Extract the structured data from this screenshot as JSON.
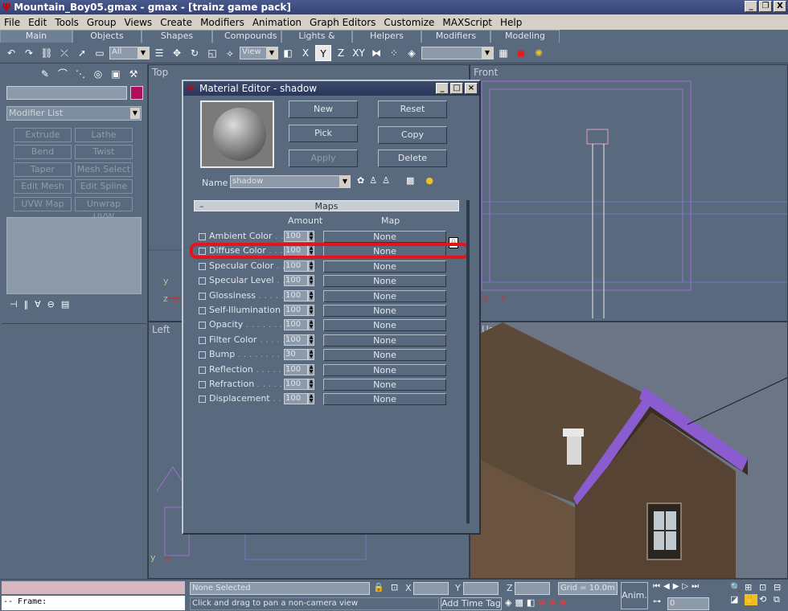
{
  "window": {
    "title": "Mountain_Boy05.gmax - gmax - [trainz game pack]",
    "controls": [
      "_",
      "❐",
      "X"
    ]
  },
  "menu": [
    "File",
    "Edit",
    "Tools",
    "Group",
    "Views",
    "Create",
    "Modifiers",
    "Animation",
    "Graph Editors",
    "Customize",
    "MAXScript",
    "Help"
  ],
  "toolbar_tabs": [
    "Main Toolbar",
    "Objects",
    "Shapes",
    "Compounds",
    "Lights & Cameras",
    "Helpers",
    "Modifiers",
    "Modeling"
  ],
  "toolbar": {
    "selection_filter": "All",
    "ref_coord": "View",
    "active_tool": "Y",
    "axis_labels": [
      "X",
      "Y",
      "Z",
      "XY"
    ]
  },
  "left_panel": {
    "modifier_list": "Modifier List",
    "modifier_buttons": [
      "Extrude",
      "Lathe",
      "Bend",
      "Twist",
      "Taper",
      "Mesh Select",
      "Edit Mesh",
      "Edit Spline",
      "UVW Map",
      "Unwrap UVW"
    ],
    "accent_color": "#b0105a"
  },
  "viewports": {
    "top": "Top",
    "front": "Front",
    "left": "Left",
    "user": "User"
  },
  "material_editor": {
    "title": "Material Editor - shadow",
    "buttons": {
      "new": "New",
      "reset": "Reset",
      "pick": "Pick",
      "copy": "Copy",
      "apply": "Apply",
      "delete": "Delete"
    },
    "name_label": "Name",
    "name_value": "shadow",
    "maps_header": "Maps",
    "maps_collapse": "–",
    "col_amount": "Amount",
    "col_map": "Map",
    "maps": [
      {
        "label": "Ambient Color",
        "dots": " . . . . . .",
        "amount": "100",
        "map": "None"
      },
      {
        "label": "Diffuse Color",
        "dots": " . . . . . .",
        "amount": "100",
        "map": "None"
      },
      {
        "label": "Specular Color",
        "dots": " . . . .",
        "amount": "100",
        "map": "None"
      },
      {
        "label": "Specular Level",
        "dots": " . . . .",
        "amount": "100",
        "map": "None"
      },
      {
        "label": "Glossiness",
        "dots": " . . . . . . . .",
        "amount": "100",
        "map": "None"
      },
      {
        "label": "Self-Illumination",
        "dots": " . . .",
        "amount": "100",
        "map": "None"
      },
      {
        "label": "Opacity",
        "dots": " . . . . . . . . . .",
        "amount": "100",
        "map": "None"
      },
      {
        "label": "Filter Color",
        "dots": " . . . . . . .",
        "amount": "100",
        "map": "None"
      },
      {
        "label": "Bump",
        "dots": " . . . . . . . . . . . .",
        "amount": "30",
        "map": "None"
      },
      {
        "label": "Reflection",
        "dots": " . . . . . . . .",
        "amount": "100",
        "map": "None"
      },
      {
        "label": "Refraction",
        "dots": " . . . . . . . .",
        "amount": "100",
        "map": "None"
      },
      {
        "label": "Displacement",
        "dots": " . . . . . .",
        "amount": "100",
        "map": "None"
      }
    ],
    "highlight_color": "#e8121a"
  },
  "status": {
    "selection": "None Selected",
    "prompt": "Click and drag to pan a non-camera view",
    "grid": "Grid = 10.0m",
    "add_time_tag": "Add Time Tag",
    "anim": "Anim.",
    "frame_label": "-- Frame:",
    "frame_value": "0",
    "coord_x": "X",
    "coord_y": "Y",
    "coord_z": "Z"
  }
}
